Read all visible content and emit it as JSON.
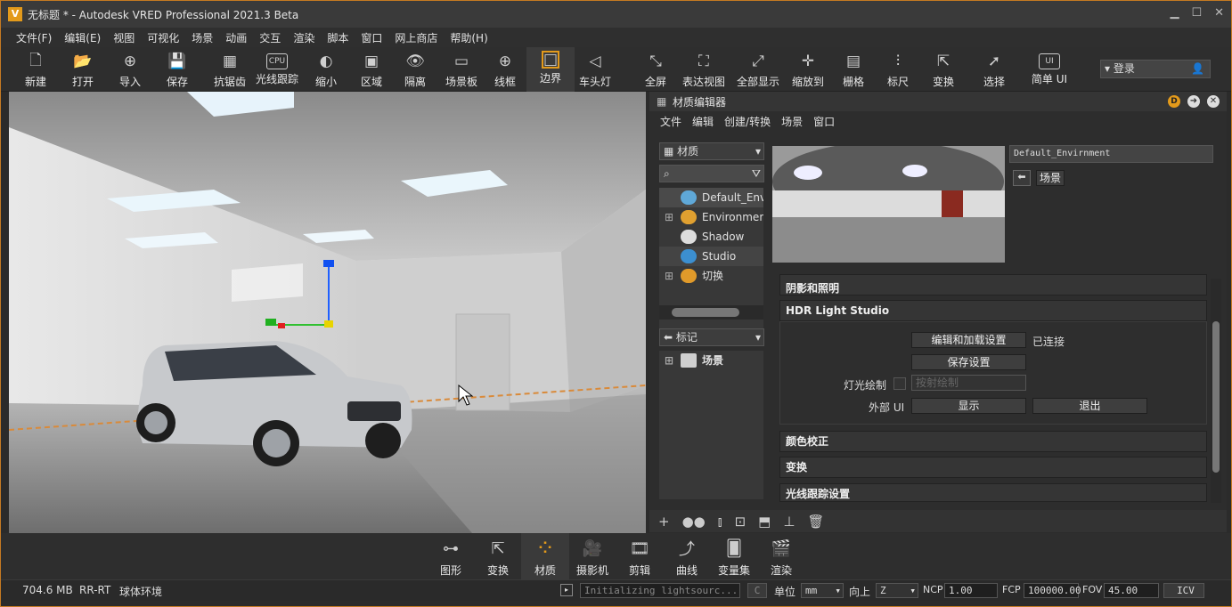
{
  "window": {
    "title": "无标题 * - Autodesk VRED Professional 2021.3 Beta",
    "logo": "V"
  },
  "menu": [
    "文件(F)",
    "编辑(E)",
    "视图",
    "可视化",
    "场景",
    "动画",
    "交互",
    "渲染",
    "脚本",
    "窗口",
    "网上商店",
    "帮助(H)"
  ],
  "toolbar": [
    {
      "label": "新建",
      "icon": "new-file-icon",
      "glyph": "🗋"
    },
    {
      "label": "打开",
      "icon": "folder-icon",
      "glyph": "📂"
    },
    {
      "label": "导入",
      "icon": "import-icon",
      "glyph": "⊕"
    },
    {
      "label": "保存",
      "icon": "save-icon",
      "glyph": "💾"
    },
    {
      "label": "抗锯齿",
      "icon": "antialias-icon",
      "glyph": "▦"
    },
    {
      "label": "光线跟踪",
      "icon": "cpu-icon",
      "glyph": "CPU"
    },
    {
      "label": "缩小",
      "icon": "contrast-icon",
      "glyph": "◐"
    },
    {
      "label": "区域",
      "icon": "region-icon",
      "glyph": "▣"
    },
    {
      "label": "隔离",
      "icon": "eye-icon",
      "glyph": "👁"
    },
    {
      "label": "场景板",
      "icon": "sceneplate-icon",
      "glyph": "▭"
    },
    {
      "label": "线框",
      "icon": "wireframe-icon",
      "glyph": "⊕"
    },
    {
      "label": "边界",
      "icon": "bounds-icon",
      "glyph": "□"
    },
    {
      "label": "车头灯",
      "icon": "headlight-icon",
      "glyph": "◁"
    },
    {
      "label": "全屏",
      "icon": "fullscreen-icon",
      "glyph": "⤡"
    },
    {
      "label": "表达视图",
      "icon": "presentation-icon",
      "glyph": "⛶"
    },
    {
      "label": "全部显示",
      "icon": "showall-icon",
      "glyph": "⤢"
    },
    {
      "label": "缩放到",
      "icon": "zoomto-icon",
      "glyph": "✛"
    },
    {
      "label": "栅格",
      "icon": "grid-icon",
      "glyph": "▤"
    },
    {
      "label": "标尺",
      "icon": "ruler-icon",
      "glyph": "⫶"
    },
    {
      "label": "变换",
      "icon": "transform-icon",
      "glyph": "⇱"
    },
    {
      "label": "选择",
      "icon": "select-icon",
      "glyph": "➚"
    },
    {
      "label": "简单 UI",
      "icon": "simple-ui-icon",
      "glyph": "UI"
    }
  ],
  "login": "登录",
  "material_editor": {
    "title": "材质编辑器",
    "menu": [
      "文件",
      "编辑",
      "创建/转换",
      "场景",
      "窗口"
    ],
    "filter_dropdown": "材质",
    "search_placeholder": "",
    "tree": [
      {
        "label": "Default_Envi",
        "color": "#5fa8d8"
      },
      {
        "label": "Environment",
        "color": "#e0a030"
      },
      {
        "label": "Shadow",
        "color": "#dddddd"
      },
      {
        "label": "Studio",
        "color": "#3c8fd0"
      },
      {
        "label": "切换",
        "color": "#e09a2a"
      }
    ],
    "tags_dropdown": "标记",
    "tags_tree": [
      "场景"
    ],
    "material_name": "Default_Envirnment",
    "scene_tag": "场景",
    "sections": {
      "shadow": "阴影和照明",
      "hdr": "HDR Light Studio",
      "color": "颜色校正",
      "transform": "变换",
      "raytrace": "光线跟踪设置"
    },
    "hdr_panel": {
      "edit_button": "编辑和加载设置",
      "connected": "已连接",
      "save_button": "保存设置",
      "light_paint_label": "灯光绘制",
      "light_paint_value": "按射绘制",
      "external_ui_label": "外部 UI",
      "show_button": "显示",
      "exit_button": "退出"
    }
  },
  "bottom_modules": [
    {
      "label": "图形",
      "icon": "graph-icon",
      "glyph": "⊶"
    },
    {
      "label": "变换",
      "icon": "transform-icon",
      "glyph": "⇱"
    },
    {
      "label": "材质",
      "icon": "materials-icon",
      "glyph": "⁘"
    },
    {
      "label": "摄影机",
      "icon": "camera-icon",
      "glyph": "🎥"
    },
    {
      "label": "剪辑",
      "icon": "clip-icon",
      "glyph": "🎞"
    },
    {
      "label": "曲线",
      "icon": "curves-icon",
      "glyph": "⤴"
    },
    {
      "label": "变量集",
      "icon": "variantsets-icon",
      "glyph": "🂠"
    },
    {
      "label": "渲染",
      "icon": "clapper-icon",
      "glyph": "🎬"
    }
  ],
  "status": {
    "memory": "704.6 MB",
    "mode": "RR-RT",
    "env": "球体环境",
    "console": "Initializing lightsourc...",
    "c_btn": "C",
    "unit_label": "单位",
    "unit": "mm",
    "up_label": "向上",
    "up": "Z",
    "ncp_label": "NCP",
    "ncp": "1.00",
    "fcp_label": "FCP",
    "fcp": "100000.00",
    "fov_label": "FOV",
    "fov": "45.00",
    "icv": "ICV"
  }
}
